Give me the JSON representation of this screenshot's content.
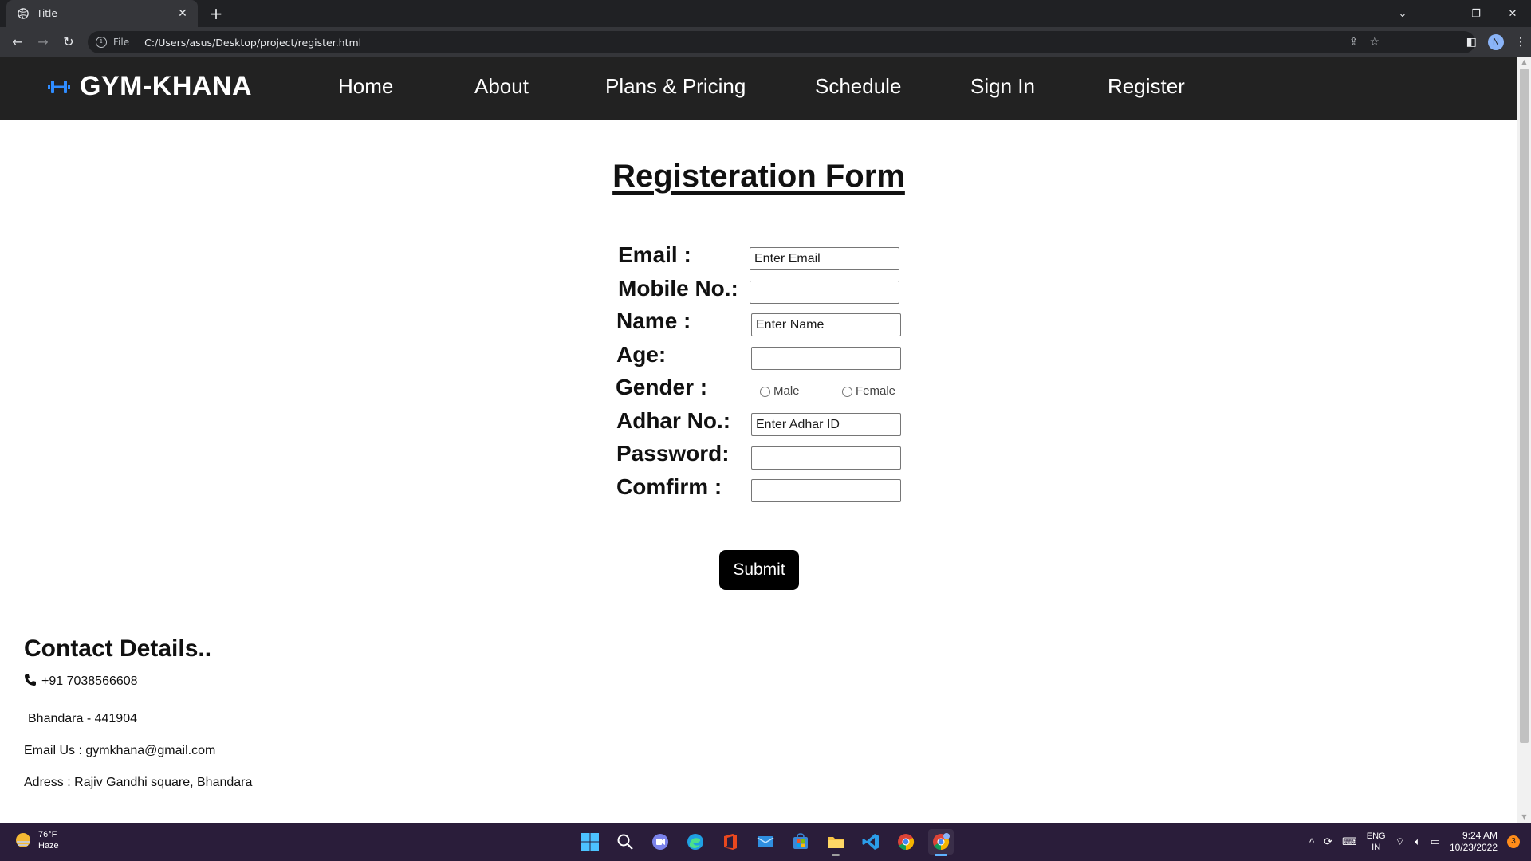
{
  "browser": {
    "tab_title": "Title",
    "file_label": "File",
    "url": "C:/Users/asus/Desktop/project/register.html",
    "profile_initial": "N"
  },
  "site": {
    "brand": "GYM-KHANA",
    "nav": [
      {
        "label": "Home"
      },
      {
        "label": "About"
      },
      {
        "label": "Plans & Pricing"
      },
      {
        "label": "Schedule"
      },
      {
        "label": "Sign In"
      },
      {
        "label": "Register"
      }
    ]
  },
  "form": {
    "heading": "Registeration Form",
    "email_label": "Email :",
    "email_placeholder": "Enter Email",
    "mobile_label": "Mobile No.:",
    "name_label": "Name :",
    "name_placeholder": "Enter Name",
    "age_label": "Age:",
    "gender_label": "Gender :",
    "gender_male": "Male",
    "gender_female": "Female",
    "adhar_label": "Adhar No.:",
    "adhar_placeholder": "Enter Adhar ID",
    "password_label": "Password:",
    "confirm_label": "Comfirm :",
    "submit_label": "Submit"
  },
  "contact": {
    "heading": "Contact Details..",
    "phone": "+91 7038566608",
    "city": "Bhandara - 441904",
    "email": "Email Us : gymkhana@gmail.com",
    "address": "Adress : Rajiv Gandhi square, Bhandara"
  },
  "taskbar": {
    "weather_temp": "76°F",
    "weather_desc": "Haze",
    "lang_top": "ENG",
    "lang_bottom": "IN",
    "time": "9:24 AM",
    "date": "10/23/2022",
    "notification_count": "3"
  },
  "colors": {
    "nav_bg": "#222222",
    "brand_icon": "#2f8cff",
    "submit_bg": "#000000",
    "taskbar_bg": "#2a1d3a"
  }
}
